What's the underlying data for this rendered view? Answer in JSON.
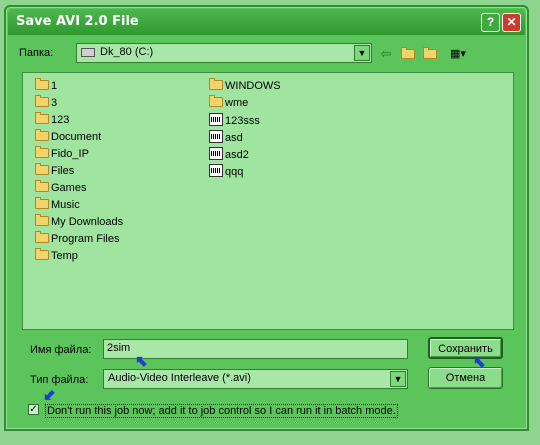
{
  "window": {
    "title": "Save AVI 2.0 File"
  },
  "location": {
    "label": "Папка:",
    "value": "Dk_80 (C:)"
  },
  "files": {
    "column1": [
      "1",
      "3",
      "123",
      "Document",
      "Fido_IP",
      "Files",
      "Games",
      "Music",
      "My Downloads",
      "Program Files",
      "Temp"
    ],
    "column2_folders": [
      "WINDOWS",
      "wme"
    ],
    "column2_files": [
      "123sss",
      "asd",
      "asd2",
      "qqq"
    ]
  },
  "filename": {
    "label": "Имя файла:",
    "value": "2sim"
  },
  "filetype": {
    "label": "Тип файла:",
    "value": "Audio-Video Interleave (*.avi)"
  },
  "buttons": {
    "save": "Сохранить",
    "cancel": "Отмена"
  },
  "batch": {
    "label": "Don't run this job now; add it to job control so I can run it in batch mode.",
    "checked": true
  }
}
